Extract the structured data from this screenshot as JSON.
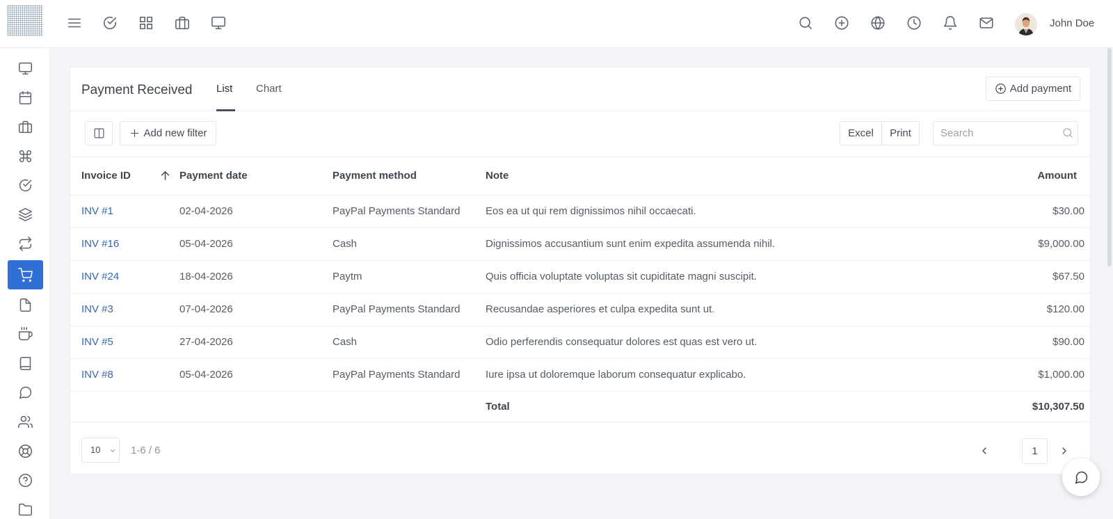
{
  "user": {
    "name": "John Doe"
  },
  "page": {
    "title": "Payment Received",
    "tabs": [
      {
        "label": "List",
        "active": true
      },
      {
        "label": "Chart",
        "active": false
      }
    ],
    "add_payment_label": "Add payment"
  },
  "toolbar": {
    "add_filter_label": "Add new filter",
    "excel_label": "Excel",
    "print_label": "Print",
    "search_placeholder": "Search"
  },
  "table": {
    "headers": [
      "Invoice ID",
      "Payment date",
      "Payment method",
      "Note",
      "Amount"
    ],
    "rows": [
      {
        "invoice": "INV #1",
        "date": "02-04-2026",
        "method": "PayPal Payments Standard",
        "note": "Eos ea ut qui rem dignissimos nihil occaecati.",
        "amount": "$30.00"
      },
      {
        "invoice": "INV #16",
        "date": "05-04-2026",
        "method": "Cash",
        "note": "Dignissimos accusantium sunt enim expedita assumenda nihil.",
        "amount": "$9,000.00"
      },
      {
        "invoice": "INV #24",
        "date": "18-04-2026",
        "method": "Paytm",
        "note": "Quis officia voluptate voluptas sit cupiditate magni suscipit.",
        "amount": "$67.50"
      },
      {
        "invoice": "INV #3",
        "date": "07-04-2026",
        "method": "PayPal Payments Standard",
        "note": "Recusandae asperiores et culpa expedita sunt ut.",
        "amount": "$120.00"
      },
      {
        "invoice": "INV #5",
        "date": "27-04-2026",
        "method": "Cash",
        "note": "Odio perferendis consequatur dolores est quas est vero ut.",
        "amount": "$90.00"
      },
      {
        "invoice": "INV #8",
        "date": "05-04-2026",
        "method": "PayPal Payments Standard",
        "note": "Iure ipsa ut doloremque laborum consequatur explicabo.",
        "amount": "$1,000.00"
      }
    ],
    "total_label": "Total",
    "total_amount": "$10,307.50"
  },
  "pagination": {
    "page_size": "10",
    "range": "1-6 / 6",
    "current_page": "1"
  },
  "icons": {
    "topbar_left": [
      "menu-icon",
      "check-circle-icon",
      "grid-icon",
      "briefcase-icon",
      "monitor-icon"
    ],
    "topbar_right": [
      "search-icon",
      "plus-circle-icon",
      "globe-icon",
      "clock-icon",
      "bell-icon",
      "mail-icon"
    ],
    "sidebar": [
      "monitor-icon",
      "calendar-icon",
      "briefcase-icon",
      "command-icon",
      "check-circle-icon",
      "layers-icon",
      "repeat-icon",
      "cart-icon",
      "file-icon",
      "coffee-icon",
      "book-icon",
      "message-icon",
      "users-icon",
      "life-buoy-icon",
      "help-circle-icon",
      "folder-icon"
    ]
  },
  "colors": {
    "accent": "#2f6fd6",
    "link": "#3567a8"
  }
}
